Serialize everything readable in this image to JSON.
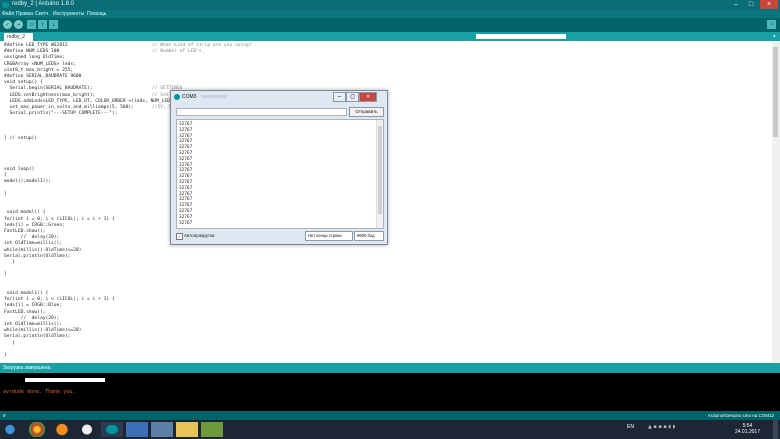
{
  "window": {
    "title": "redby_2 | Arduino 1.8.0"
  },
  "menu": [
    "Файл",
    "Правка",
    "Скетч",
    "Инструменты",
    "Помощь"
  ],
  "tab": {
    "label": "redby_2"
  },
  "code_lines": [
    {
      "t": "#define LED_TYPE WS2812",
      "c": "// What kind of strip are you using?"
    },
    {
      "t": "#define NUM_LEDS 100",
      "c": "// Number of LED's."
    },
    {
      "t": "unsigned long OldTime;",
      "c": ""
    },
    {
      "t": "CRGBArray <NUM_LEDS> leds;",
      "c": ""
    },
    {
      "t": "uint8_t max_bright = 255;",
      "c": ""
    },
    {
      "t": "#define SERIAL_BAUDRATE 9600",
      "c": ""
    },
    {
      "t": "void setup() {",
      "c": ""
    },
    {
      "t": "  Serial.begin(SERIAL_BAUDRATE);",
      "c": "// SETTINGS"
    },
    {
      "t": "  LEDS.setBrightness(max_bright);",
      "c": "// Set"
    },
    {
      "t": "  LEDS.addLeds<LED_TYPE, LED_DT, COLOR_ORDER >(leds, NUM_LEDS); // WS2",
      "c": ""
    },
    {
      "t": "  set_max_power_in_volts_and_milliamps(5, 500);",
      "c": "//5V, 5"
    },
    {
      "t": "  Serial.println(\"---SETUP COMPLETE---\");",
      "c": ""
    },
    {
      "t": "",
      "c": ""
    },
    {
      "t": "",
      "c": ""
    },
    {
      "t": "",
      "c": ""
    },
    {
      "t": "} // setup()",
      "c": ""
    },
    {
      "t": "",
      "c": ""
    },
    {
      "t": "",
      "c": ""
    },
    {
      "t": "",
      "c": ""
    },
    {
      "t": "",
      "c": ""
    },
    {
      "t": "void loop()",
      "c": ""
    },
    {
      "t": "{",
      "c": ""
    },
    {
      "t": "model();model1();",
      "c": ""
    },
    {
      "t": "",
      "c": ""
    },
    {
      "t": "}",
      "c": ""
    },
    {
      "t": "",
      "c": ""
    },
    {
      "t": "",
      "c": ""
    },
    {
      "t": " void model() {",
      "c": ""
    },
    {
      "t": "for(int i = 0; i < (LICOL); i = i + 1) {",
      "c": ""
    },
    {
      "t": "leds[i] = CRGB::Green;",
      "c": ""
    },
    {
      "t": "FastLED.show();",
      "c": ""
    },
    {
      "t": "      //  delay(20);",
      "c": ""
    },
    {
      "t": "int OldTime=millis();",
      "c": ""
    },
    {
      "t": "while(millis()-OldTime)<=20)",
      "c": ""
    },
    {
      "t": "Serial.println(OldTime);",
      "c": ""
    },
    {
      "t": "   }",
      "c": ""
    },
    {
      "t": "",
      "c": ""
    },
    {
      "t": "}",
      "c": ""
    },
    {
      "t": "",
      "c": ""
    },
    {
      "t": "",
      "c": ""
    },
    {
      "t": " void model1() {",
      "c": ""
    },
    {
      "t": "for(int i = 0; i < (LICOL); i = i + 1) {",
      "c": ""
    },
    {
      "t": "leds[i] = CRGB::Blue;",
      "c": ""
    },
    {
      "t": "FastLED.show();",
      "c": ""
    },
    {
      "t": "      //  delay(20);",
      "c": ""
    },
    {
      "t": "int OldTime=millis();",
      "c": ""
    },
    {
      "t": "while(millis()-OldTime)<=20)",
      "c": ""
    },
    {
      "t": "Serial.println(OldTime);",
      "c": ""
    },
    {
      "t": "   }",
      "c": ""
    },
    {
      "t": "",
      "c": ""
    },
    {
      "t": "}",
      "c": ""
    }
  ],
  "status": {
    "message": "Загрузка завершена.",
    "console": "avrdude done.  Thank you.",
    "board": "Arduino/Genuino Uno на COM12"
  },
  "serial_monitor": {
    "title": "COM3",
    "send_label": "Отправить",
    "output": [
      "32767",
      "32767",
      "32767",
      "32767",
      "32767",
      "32767",
      "32767",
      "32767",
      "32767",
      "32767",
      "32767",
      "32767",
      "32767",
      "32767",
      "32767",
      "32767",
      "32767",
      "32767"
    ],
    "autoscroll_label": "Автопрокрутка",
    "line_ending": "Нет конца строки",
    "baud": "9600 бод"
  },
  "taskbar": {
    "lang": "EN",
    "time": "5:54",
    "date": "24.01.2017"
  },
  "colors": {
    "accent": "#00979c",
    "dark": "#006468",
    "tab": "#17a1a5",
    "console_text": "#e06020"
  }
}
